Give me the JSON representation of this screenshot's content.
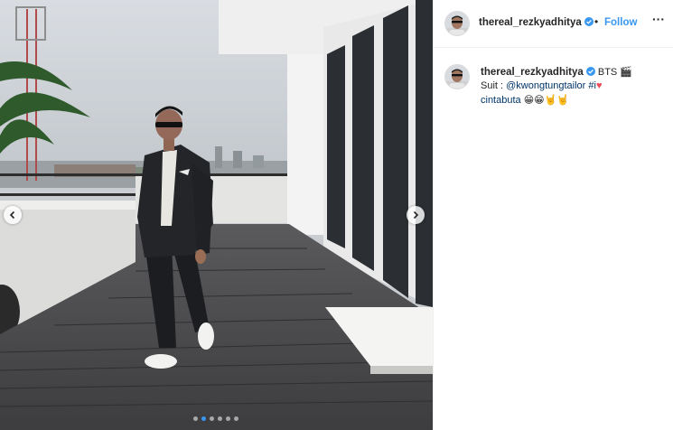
{
  "post": {
    "username": "thereal_rezkyadhitya",
    "follow_label": "Follow",
    "separator": "•",
    "more_label": "···"
  },
  "caption": {
    "username": "thereal_rezkyadhitya",
    "line1_text": "BTS ",
    "line1_emoji": "🎬",
    "line2_prefix": "Suit : ",
    "mention": "@kwongtungtailor",
    "hashtag_start": "#i",
    "heart": "♥",
    "hashtag_end": "cintabuta",
    "trailing_emojis": "😁😁🤘🤘"
  },
  "carousel": {
    "slide_count": 6,
    "active_index": 1
  },
  "colors": {
    "link_blue": "#3897f0",
    "mention_navy": "#003569",
    "verified_blue": "#3897f0",
    "heart_red": "#ed4956"
  },
  "icons": {
    "prev": "chevron-left-icon",
    "next": "chevron-right-icon",
    "verified": "verified-badge-icon"
  }
}
